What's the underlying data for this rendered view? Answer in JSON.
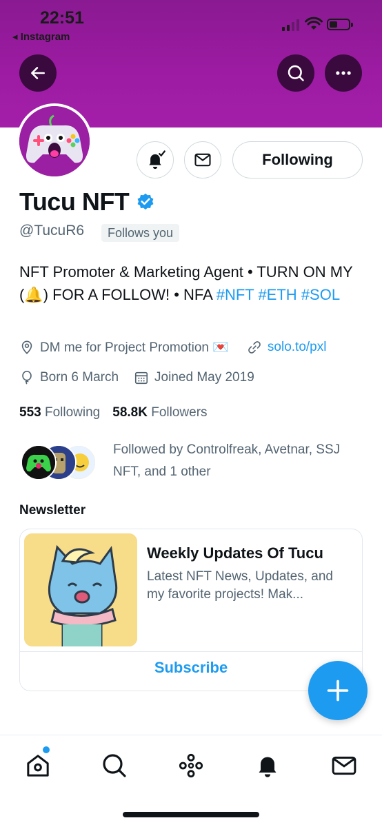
{
  "status_bar": {
    "time": "22:51",
    "back_app": "◂ Instagram"
  },
  "header": {
    "back_icon": "arrow-left-icon",
    "search_icon": "search-icon",
    "more_icon": "more-horizontal-icon"
  },
  "profile": {
    "name": "Tucu NFT",
    "handle": "@TucuR6",
    "follows_you": "Follows you",
    "following_label": "Following",
    "bio_text": "NFT Promoter & Marketing Agent • TURN ON MY (🔔) FOR A FOLLOW! • NFA ",
    "bio_tags": [
      "#NFT",
      "#ETH",
      "#SOL"
    ],
    "location": "DM me for Project Promotion 💌",
    "website": "solo.to/pxl",
    "birthday": "Born 6 March",
    "joined": "Joined May 2019",
    "following_count": "553",
    "following_label_count": "Following",
    "followers_count": "58.8K",
    "followers_label": "Followers",
    "followed_by": "Followed by Controlfreak, Avetnar, SSJ NFT, and 1 other"
  },
  "newsletter": {
    "section_title": "Newsletter",
    "title": "Weekly Updates Of Tucu",
    "description": "Latest NFT News, Updates, and my favorite projects! Mak...",
    "subscribe_label": "Subscribe"
  },
  "colors": {
    "banner": "#9c1ba2",
    "accent": "#1d9bf0",
    "text_primary": "#0f1419",
    "text_secondary": "#536471"
  },
  "tabbar": {
    "items": [
      "home-icon",
      "search-icon",
      "spaces-icon",
      "notifications-icon",
      "messages-icon"
    ]
  }
}
